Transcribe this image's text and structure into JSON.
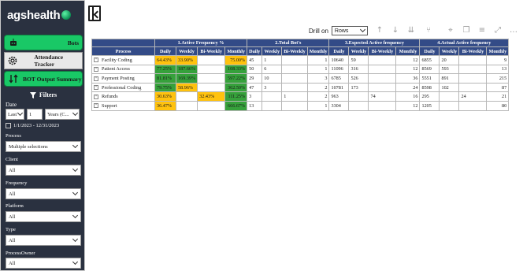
{
  "app": {
    "logo_text": "agshealth"
  },
  "sidebar": {
    "bots_label": "Bots",
    "attendance_label": "Attendance Tracker",
    "bot_output_label": "BOT Output Summary",
    "filters_title": "Filters",
    "date_label": "Date",
    "date_mode": "Last",
    "date_count": "1",
    "date_unit": "Years (C...",
    "date_range": "1/1/2023 - 12/31/2023",
    "process_label": "Process",
    "process_value": "Multiple selections",
    "client_label": "Client",
    "client_value": "All",
    "frequency_label": "Frequency",
    "frequency_value": "All",
    "platform_label": "Platform",
    "platform_value": "All",
    "type_label": "Type",
    "type_value": "All",
    "owner_label": "ProcessOwner",
    "owner_value": "All"
  },
  "toolbar": {
    "drill_on": "Drill on",
    "drill_value": "Rows"
  },
  "table": {
    "groups": [
      "1.Active Frequency %",
      "2.Total Bot's",
      "3.Expected Active frequency",
      "4.Actual Active frequency"
    ],
    "process_header": "Process",
    "sub_headers": [
      "Daily",
      "Weekly",
      "Bi-Weekly",
      "Monthly"
    ],
    "rows": [
      {
        "name": "Facility Coding",
        "cells": [
          "64.43%",
          "33.90%",
          "",
          "75.00%",
          "45",
          "1",
          "",
          "1",
          "10640",
          "59",
          "",
          "12",
          "6855",
          "20",
          "",
          "9"
        ]
      },
      {
        "name": "Patient Access",
        "cells": [
          "77.25%",
          "187.66%",
          "",
          "108.33%",
          "50",
          "6",
          "",
          "1",
          "11096",
          "316",
          "",
          "12",
          "8569",
          "593",
          "",
          "13"
        ]
      },
      {
        "name": "Payment Posting",
        "cells": [
          "81.81%",
          "169.39%",
          "",
          "597.22%",
          "29",
          "10",
          "",
          "3",
          "6785",
          "526",
          "",
          "36",
          "5551",
          "891",
          "",
          "215"
        ]
      },
      {
        "name": "Professional Coding",
        "cells": [
          "79.75%",
          "58.96%",
          "",
          "362.50%",
          "47",
          "3",
          "",
          "2",
          "10781",
          "173",
          "",
          "24",
          "8598",
          "102",
          "",
          "87"
        ]
      },
      {
        "name": "Refunds",
        "cells": [
          "30.63%",
          "",
          "32.43%",
          "111.25%",
          "3",
          "",
          "1",
          "2",
          "963",
          "",
          "74",
          "16",
          "295",
          "",
          "24",
          "21"
        ]
      },
      {
        "name": "Support",
        "cells": [
          "36.47%",
          "",
          "",
          "666.67%",
          "13",
          "",
          "",
          "1",
          "3304",
          "",
          "",
          "12",
          "1205",
          "",
          "",
          "80"
        ]
      }
    ]
  },
  "colors": {
    "sidebar_bg": "#2a3140",
    "accent_green": "#19c866",
    "header_blue": "#334b87",
    "cell_yellow": "#ffc20e",
    "cell_green": "#36a13b"
  }
}
